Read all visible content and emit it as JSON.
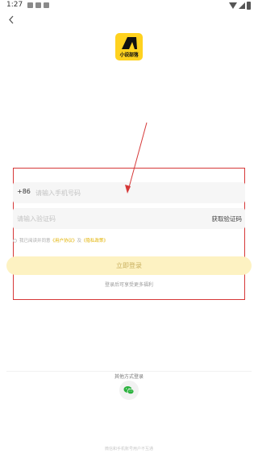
{
  "status_bar": {
    "time": "1:27"
  },
  "logo": {
    "text": "小说部落"
  },
  "phone": {
    "country_code": "+86",
    "placeholder": "请输入手机号码"
  },
  "code": {
    "placeholder": "请输入验证码",
    "get_code_label": "获取验证码"
  },
  "agreement": {
    "prefix": "我已阅读并同意",
    "user_agreement": "《用户协议》",
    "and": "及",
    "privacy_policy": "《隐私政策》"
  },
  "login": {
    "button_label": "立即登录",
    "hint": "登录后可享受更多福利"
  },
  "other": {
    "label": "其他方式登录"
  },
  "footer": {
    "note": "微信和手机账号用户不互通"
  },
  "colors": {
    "brand_yellow": "#ffd21f",
    "button_bg": "#fdf2c2",
    "annotation_red": "#d63838",
    "wechat_green": "#2ab23d"
  }
}
